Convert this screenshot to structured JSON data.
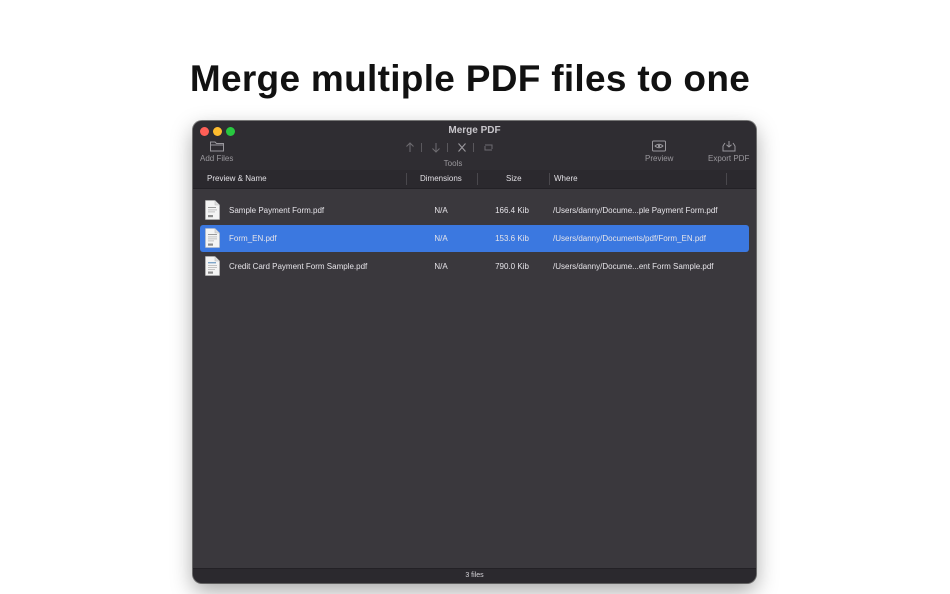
{
  "headline": "Merge multiple PDF files to one",
  "window": {
    "title": "Merge PDF"
  },
  "toolbar": {
    "add_files_label": "Add Files",
    "tools_label": "Tools",
    "preview_label": "Preview",
    "export_label": "Export PDF"
  },
  "columns": {
    "name": "Preview & Name",
    "dimensions": "Dimensions",
    "size": "Size",
    "where": "Where"
  },
  "files": [
    {
      "name": "Sample Payment Form.pdf",
      "dimensions": "N/A",
      "size": "166.4 Kib",
      "where": "/Users/danny/Docume...ple Payment Form.pdf",
      "selected": false
    },
    {
      "name": "Form_EN.pdf",
      "dimensions": "N/A",
      "size": "153.6 Kib",
      "where": "/Users/danny/Documents/pdf/Form_EN.pdf",
      "selected": true
    },
    {
      "name": "Credit Card Payment Form Sample.pdf",
      "dimensions": "N/A",
      "size": "790.0 Kib",
      "where": "/Users/danny/Docume...ent Form Sample.pdf",
      "selected": false
    }
  ],
  "status": "3 files",
  "colors": {
    "selection": "#3b78e0",
    "window_bg": "#3a383d",
    "titlebar_bg": "#2f2d32"
  }
}
